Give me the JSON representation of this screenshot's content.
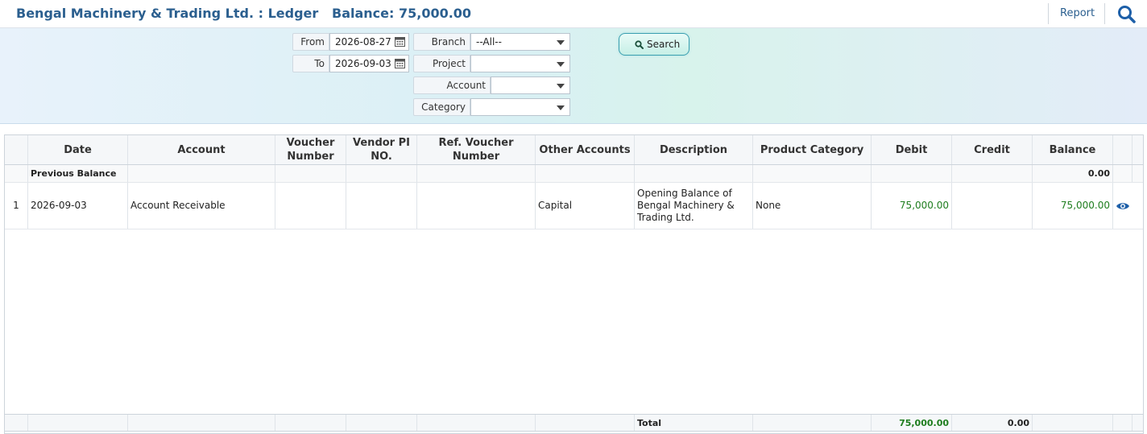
{
  "header": {
    "title": "Bengal Machinery & Trading Ltd. : Ledger",
    "balance": "Balance: 75,000.00",
    "report_label": "Report"
  },
  "filters": {
    "from_label": "From",
    "from_value": "2026-08-27",
    "to_label": "To",
    "to_value": "2026-09-03",
    "branch_label": "Branch",
    "branch_value": "--All--",
    "project_label": "Project",
    "project_value": "",
    "account_label": "Account",
    "account_value": "",
    "category_label": "Category",
    "category_value": "",
    "search_label": "Search"
  },
  "table": {
    "columns": [
      "Date",
      "Account",
      "Voucher Number",
      "Vendor PI NO.",
      "Ref. Voucher Number",
      "Other Accounts",
      "Description",
      "Product Category",
      "Debit",
      "Credit",
      "Balance"
    ],
    "previous_balance": {
      "label": "Previous Balance",
      "balance": "0.00"
    },
    "rows": [
      {
        "index": "1",
        "date": "2026-09-03",
        "account": "Account Receivable",
        "voucher_number": "",
        "vendor_pi_no": "",
        "ref_voucher_number": "",
        "other_accounts": "Capital",
        "description": "Opening Balance of Bengal Machinery & Trading Ltd.",
        "product_category": "None",
        "debit": "75,000.00",
        "credit": "",
        "balance": "75,000.00"
      }
    ],
    "total": {
      "label": "Total",
      "debit": "75,000.00",
      "credit": "0.00"
    }
  },
  "colors": {
    "accent": "#2b5f8f",
    "positive": "#1e7d1e",
    "icon": "#1d5fa8"
  }
}
